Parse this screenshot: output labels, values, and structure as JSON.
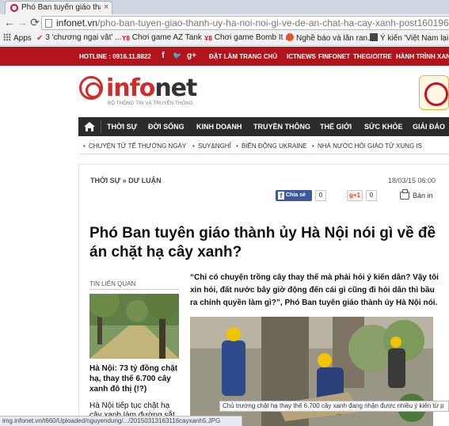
{
  "browser": {
    "tab_title": "Phó Ban tuyên giáo thành",
    "tab_close": "×",
    "back": "←",
    "forward": "→",
    "reload": "⟳",
    "url_domain": "infonet.vn",
    "url_path": "/pho-ban-tuyen-giao-thanh-uy-ha-noi-noi-gi-ve-de-an-chat-ha-cay-xanh-post160196.i",
    "bookmarks": [
      {
        "label": "Apps"
      },
      {
        "label": "3 'chương ngại vật' ..."
      },
      {
        "label": "Chơi game AZ Tank ..."
      },
      {
        "label": "Chơi game Bomb It ..."
      },
      {
        "label": "Nghề báo và lăn ran..."
      },
      {
        "label": "Ý kiến 'Việt Nam lại ..."
      }
    ],
    "status_url": "img.infonet.vn/t660/Uploaded/nguyendung/.../20150313163116cayxanh5.JPG"
  },
  "topbar": {
    "hotline": "HOTLINE : 0916.11.8822",
    "social": [
      "f",
      "🐦",
      "g+"
    ],
    "links": [
      "ĐẶT LÀM TRANG CHỦ",
      "ICTNEWS",
      "FINFONET",
      "THEGIOITRE",
      "HÀNH TRÌNH XAN"
    ]
  },
  "logo": {
    "text_red": "info",
    "text_dark": "net",
    "tagline": "BỘ THÔNG TIN VÀ TRUYỀN THÔNG"
  },
  "nav": {
    "items": [
      "THỜI SỰ",
      "ĐỜI SỐNG",
      "KINH DOANH",
      "TRUYỀN THÔNG",
      "THẾ GIỚI",
      "SỨC KHỎE",
      "GIẢI ĐÁO"
    ]
  },
  "subnav": {
    "bullet": "•",
    "items": [
      "CHUYỆN TỬ TẾ THƯỜNG NGÀY",
      "SUY&NGHĨ",
      "BIẾN ĐỘNG UKRAINE",
      "NHÀ NƯỚC HỎI GIÁO TỬ XUNG IS"
    ]
  },
  "article": {
    "breadcrumb": "THỜI SỰ » DƯ LUẬN",
    "date": "18/03/15 06:00",
    "fb_label": "Chia sẻ",
    "fb_icon": "f",
    "fb_count": "0",
    "gplus_label": "g+1",
    "gplus_count": "0",
    "print_label": "Bản in",
    "headline": "Phó Ban tuyên giáo thành ủy Hà Nội nói gì về đề án chặt hạ cây xanh?",
    "lead": "“Chỉ có chuyện trồng cây thay thế mà phải hỏi ý kiến dân? Vậy tôi xin hỏi, đất nước bây giờ động đến cái gì cũng đi hỏi dân thì bầu ra chính quyền làm gì?”, Phó Ban tuyên giáo thành ủy Hà Nội nói.",
    "caption": "Chủ trương chặt hạ thay thế 6.700 cây xanh đang nhận được nhiều ý kiến từ p"
  },
  "related": {
    "title": "TIN LIÊN QUAN",
    "link1": "Hà Nội: 73 tỷ đồng chặt hạ, thay thế 6.700 cây xanh đô thị (!?)",
    "link2": "Hà Nội tiếp tục chặt hạ cây xanh làm đường sắt"
  },
  "colors": {
    "brand_red": "#b1151b",
    "nav_dark": "#2b2b2b",
    "facebook": "#3b5998"
  }
}
